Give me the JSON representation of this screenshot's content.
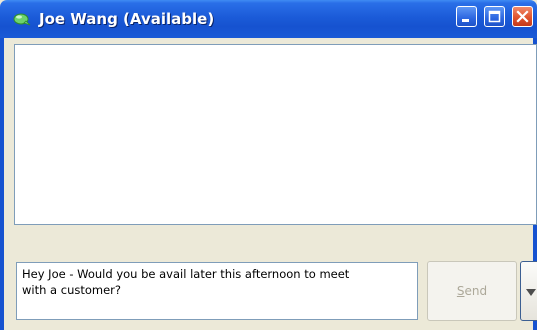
{
  "window": {
    "title": "Joe Wang (Available)"
  },
  "titlebar_buttons": {
    "minimize_icon": "minimize-icon",
    "maximize_icon": "maximize-icon",
    "close_icon": "close-icon"
  },
  "compose": {
    "line1": "Hey Joe - Would you be avail later this afternoon to meet",
    "line2": "with a customer?"
  },
  "send": {
    "accesskey": "S",
    "rest": "end"
  },
  "colors": {
    "titlebar": "#1652d0",
    "window_bg": "#ece9d8",
    "close_button": "#e0542e",
    "disabled_text": "#aca899"
  }
}
